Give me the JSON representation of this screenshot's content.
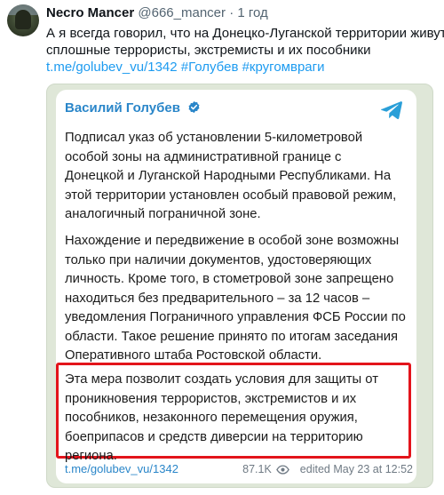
{
  "tweet": {
    "author_name": "Necro Mancer",
    "handle": "@666_mancer",
    "separator": "·",
    "time": "1 год",
    "text_lines": [
      "А я всегда говорил, что на Донецко-Луганской территории живут",
      "сплошные террористы, экстремисты и их пособники"
    ],
    "link": "t.me/golubev_vu/1342",
    "hashtags": [
      "#Голубев",
      "#кругомвраги"
    ]
  },
  "embed": {
    "author": "Василий Голубев",
    "paragraph1": [
      "Подписал указ об установлении 5-километровой",
      "особой зоны на административной границе с",
      "Донецкой и Луганской Народными Республиками. На",
      "этой территории установлен особый правовой режим,",
      "аналогичный пограничной зоне."
    ],
    "paragraph2": [
      "Нахождение и передвижение в особой зоне возможны",
      "только при наличии документов, удостоверяющих",
      "личность. Кроме того, в стометровой зоне запрещено",
      "находиться без предварительного – за 12 часов –",
      "уведомления Пограничного управления ФСБ России по",
      "области. Такое решение принято по итогам заседания",
      "Оперативного штаба Ростовской области."
    ],
    "paragraph3": [
      "Эта мера позволит создать условия для защиты от",
      "проникновения террористов, экстремистов и их",
      "пособников, незаконного перемещения оружия,",
      "боеприпасов и средств диверсии на территорию",
      "региона."
    ],
    "footer_link": "t.me/golubev_vu/1342",
    "views": "87.1K",
    "edited": "edited",
    "date": "May 23 at 12:52"
  },
  "colors": {
    "link_blue": "#1d9bf0",
    "telegram_blue": "#2a86c9",
    "highlight_red": "#e3141b",
    "card_bg": "#dfe7d8"
  },
  "icons": {
    "verified": "verified-badge-icon",
    "telegram": "telegram-logo-icon",
    "views": "eye-icon"
  }
}
